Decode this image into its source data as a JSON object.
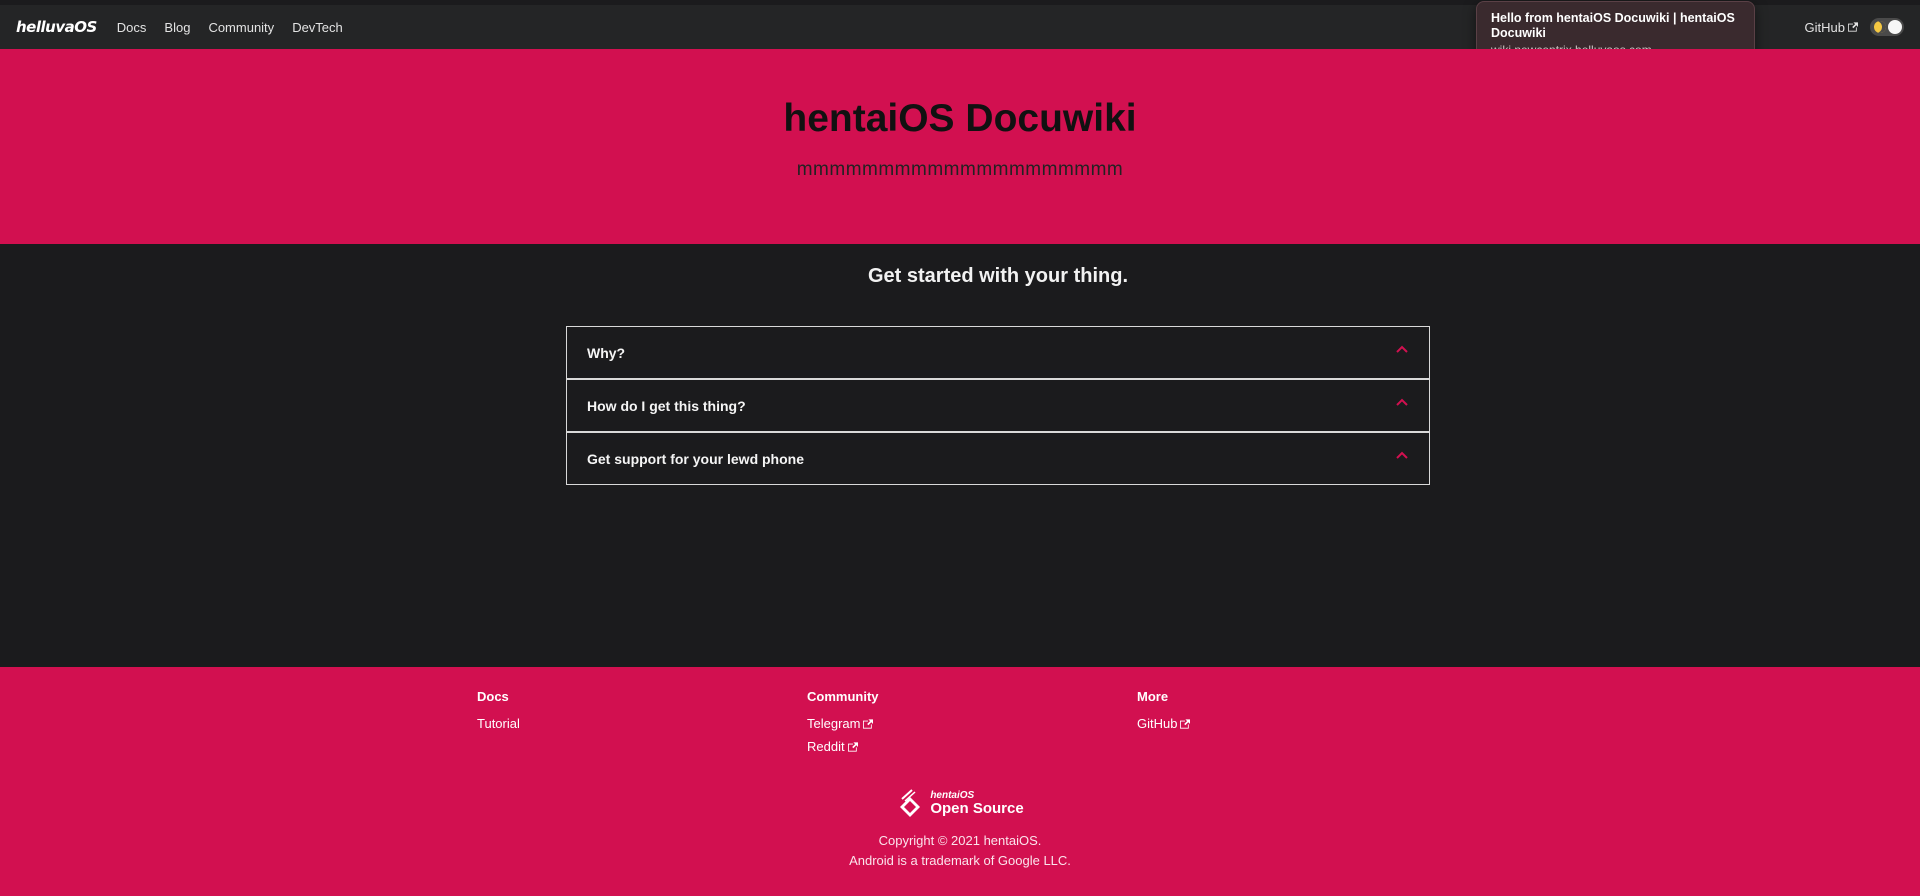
{
  "nav": {
    "brand": "helluvaOS",
    "links": [
      "Docs",
      "Blog",
      "Community",
      "DevTech"
    ],
    "github": "GitHub"
  },
  "tooltip": {
    "title": "Hello from hentaiOS Docuwiki | hentaiOS Docuwiki",
    "url": "wiki.newcentrix.helluvaos.com"
  },
  "hero": {
    "title": "hentaiOS Docuwiki",
    "subtitle": "mmmmmmmmmmmmmmmmmmmm"
  },
  "main": {
    "heading": "Get started with your thing.",
    "accordion": [
      "Why?",
      "How do I get this thing?",
      "Get support for your lewd phone"
    ]
  },
  "footer": {
    "columns": [
      {
        "title": "Docs",
        "links": [
          "Tutorial"
        ]
      },
      {
        "title": "Community",
        "links": [
          "Telegram",
          "Reddit"
        ]
      },
      {
        "title": "More",
        "links": [
          "GitHub"
        ]
      }
    ],
    "logo_top": "hentaiOS",
    "logo_bottom": "Open Source",
    "copyright": "Copyright © 2021 hentaiOS.",
    "trademark": "Android is a trademark of Google LLC."
  },
  "colors": {
    "accent": "#d21050",
    "navbar": "#242526",
    "background": "#1b1b1d"
  },
  "icons": [
    "external-link-icon",
    "chevron-up-icon",
    "moon-icon",
    "hentaios-logo-icon"
  ]
}
